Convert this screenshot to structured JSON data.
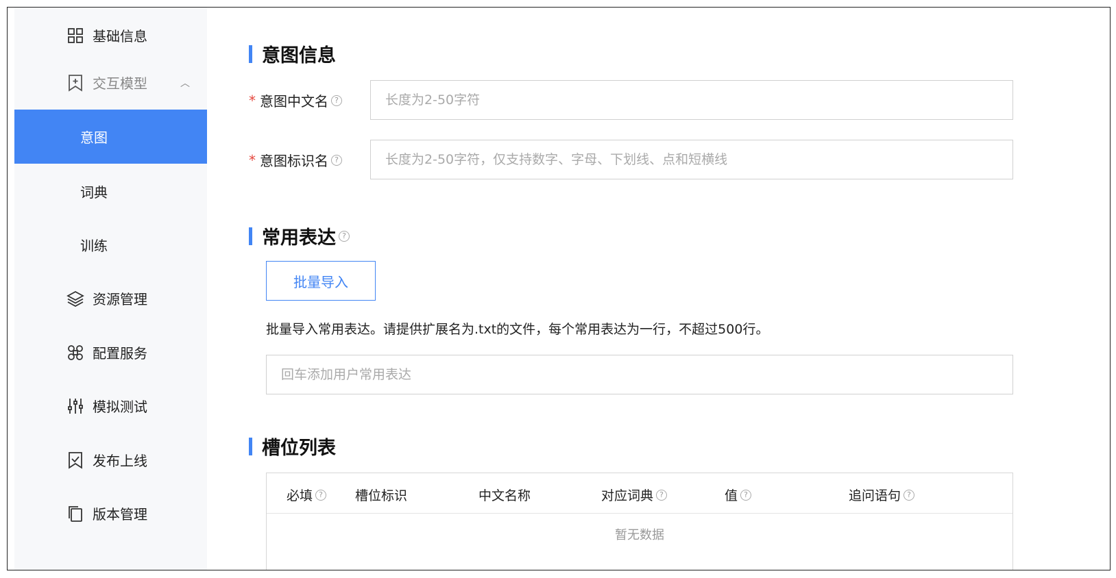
{
  "sidebar": {
    "items": [
      {
        "label": "基础信息",
        "icon": "grid-icon"
      },
      {
        "label": "交互模型",
        "icon": "bookmark-plus-icon"
      },
      {
        "label": "意图"
      },
      {
        "label": "词典"
      },
      {
        "label": "训练"
      },
      {
        "label": "资源管理",
        "icon": "layers-icon"
      },
      {
        "label": "配置服务",
        "icon": "command-icon"
      },
      {
        "label": "模拟测试",
        "icon": "sliders-icon"
      },
      {
        "label": "发布上线",
        "icon": "publish-icon"
      },
      {
        "label": "版本管理",
        "icon": "copy-icon"
      }
    ],
    "active_color": "#4285f4"
  },
  "intent_info": {
    "title": "意图信息",
    "name_label": "意图中文名",
    "name_placeholder": "长度为2-50字符",
    "id_label": "意图标识名",
    "id_placeholder": "长度为2-50字符，仅支持数字、字母、下划线、点和短横线"
  },
  "expressions": {
    "title": "常用表达",
    "import_button": "批量导入",
    "import_desc": "批量导入常用表达。请提供扩展名为.txt的文件，每个常用表达为一行，不超过500行。",
    "input_placeholder": "回车添加用户常用表达"
  },
  "slots": {
    "title": "槽位列表",
    "columns": [
      "必填",
      "槽位标识",
      "中文名称",
      "对应词典",
      "值",
      "追问语句"
    ],
    "empty_text": "暂无数据"
  },
  "accent": "#4285f4",
  "required_color": "#e5483e"
}
